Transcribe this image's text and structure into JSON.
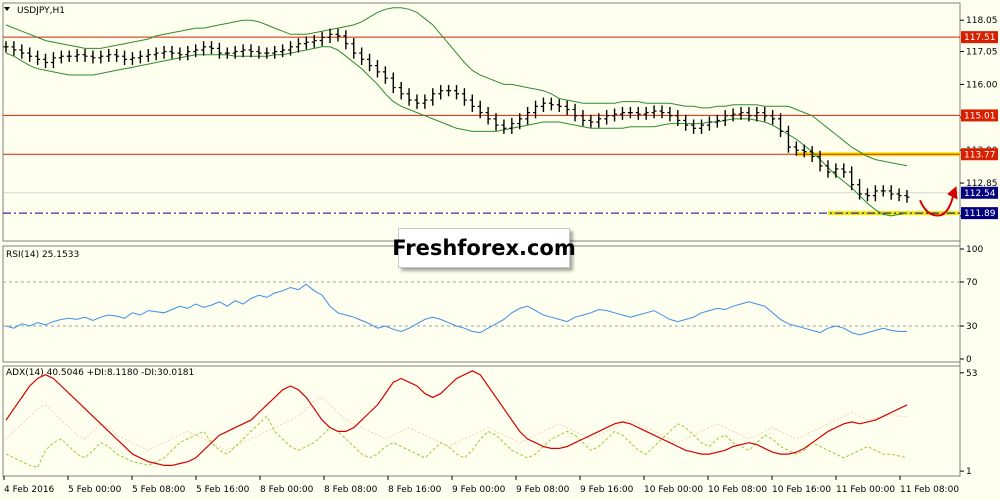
{
  "colors": {
    "background": "#fffff0",
    "candle": "#000000",
    "bollinger": "#2e8b2e",
    "resistance": "#d62000",
    "support_dash": "#00008b",
    "highlight": "#f2e600",
    "rsi_line": "#3c8ee6",
    "adx_line": "#d40000",
    "plus_di": "#99cc33",
    "minus_di": "#f5d0b0",
    "arrow": "#d40000",
    "tag_red": "#d62000",
    "tag_navy": "#000080",
    "tag_last": "#000080"
  },
  "watermark": "Freshforex.com",
  "chart_data": [
    {
      "type": "candlestick",
      "title": "USDJPY,H1",
      "ylim": [
        111.0,
        118.6
      ],
      "yticks": [
        "118.05",
        "117.05",
        "116.00",
        "114.95",
        "113.90",
        "112.85",
        "111.80"
      ],
      "x_labels": [
        "4 Feb 2016",
        "5 Feb 00:00",
        "5 Feb 08:00",
        "5 Feb 16:00",
        "8 Feb 00:00",
        "8 Feb 08:00",
        "8 Feb 16:00",
        "9 Feb 00:00",
        "9 Feb 08:00",
        "9 Feb 16:00",
        "10 Feb 00:00",
        "10 Feb 08:00",
        "10 Feb 16:00",
        "11 Feb 00:00",
        "11 Feb 08:00"
      ],
      "close": [
        117.2,
        117.1,
        117.0,
        116.9,
        116.8,
        116.7,
        116.85,
        116.9,
        116.9,
        116.95,
        116.9,
        116.85,
        116.9,
        116.95,
        116.9,
        116.8,
        116.85,
        116.9,
        116.95,
        117.0,
        117.05,
        117.0,
        116.95,
        117.05,
        117.1,
        117.2,
        117.15,
        117.0,
        117.0,
        117.05,
        117.1,
        117.05,
        117.0,
        117.0,
        117.05,
        117.1,
        117.2,
        117.3,
        117.35,
        117.4,
        117.5,
        117.6,
        117.55,
        117.3,
        117.0,
        116.8,
        116.6,
        116.4,
        116.2,
        115.9,
        115.7,
        115.5,
        115.4,
        115.5,
        115.7,
        115.8,
        115.8,
        115.7,
        115.5,
        115.3,
        115.1,
        114.9,
        114.7,
        114.6,
        114.75,
        114.9,
        115.1,
        115.3,
        115.4,
        115.35,
        115.3,
        115.2,
        115.0,
        114.85,
        114.8,
        114.9,
        115.0,
        115.05,
        115.1,
        115.1,
        115.05,
        115.1,
        115.15,
        115.1,
        115.0,
        114.85,
        114.7,
        114.6,
        114.7,
        114.8,
        114.85,
        115.0,
        115.05,
        115.1,
        115.0,
        115.1,
        115.0,
        114.9,
        114.5,
        114.0,
        113.9,
        113.85,
        113.7,
        113.4,
        113.2,
        113.3,
        113.2,
        112.8,
        112.5,
        112.45,
        112.6,
        112.6,
        112.5,
        112.45,
        112.4
      ],
      "bollinger_upper": [
        117.9,
        117.8,
        117.7,
        117.6,
        117.5,
        117.4,
        117.35,
        117.3,
        117.25,
        117.2,
        117.15,
        117.15,
        117.15,
        117.2,
        117.25,
        117.3,
        117.35,
        117.4,
        117.45,
        117.55,
        117.6,
        117.65,
        117.7,
        117.75,
        117.8,
        117.8,
        117.85,
        117.9,
        117.95,
        118.0,
        118.05,
        118.05,
        118.0,
        117.9,
        117.8,
        117.7,
        117.6,
        117.6,
        117.6,
        117.65,
        117.7,
        117.75,
        117.8,
        117.85,
        117.9,
        118.0,
        118.15,
        118.3,
        118.4,
        118.45,
        118.45,
        118.4,
        118.3,
        118.1,
        117.9,
        117.6,
        117.3,
        117.0,
        116.7,
        116.45,
        116.3,
        116.2,
        116.1,
        116.0,
        116.0,
        115.95,
        115.9,
        115.85,
        115.8,
        115.7,
        115.55,
        115.5,
        115.45,
        115.4,
        115.4,
        115.4,
        115.4,
        115.4,
        115.45,
        115.45,
        115.45,
        115.4,
        115.4,
        115.4,
        115.4,
        115.35,
        115.3,
        115.3,
        115.25,
        115.25,
        115.3,
        115.3,
        115.35,
        115.35,
        115.35,
        115.35,
        115.3,
        115.3,
        115.3,
        115.3,
        115.2,
        115.1,
        115.0,
        114.8,
        114.6,
        114.4,
        114.2,
        114.0,
        113.85,
        113.7,
        113.6,
        113.55,
        113.5,
        113.45,
        113.4
      ],
      "bollinger_lower": [
        117.0,
        116.9,
        116.75,
        116.6,
        116.5,
        116.45,
        116.4,
        116.35,
        116.3,
        116.3,
        116.3,
        116.3,
        116.35,
        116.4,
        116.45,
        116.5,
        116.55,
        116.6,
        116.65,
        116.7,
        116.75,
        116.8,
        116.85,
        116.9,
        116.95,
        116.95,
        116.95,
        116.95,
        116.95,
        116.9,
        116.9,
        116.9,
        116.9,
        116.9,
        116.95,
        116.95,
        117.0,
        117.05,
        117.1,
        117.15,
        117.2,
        117.2,
        117.1,
        116.9,
        116.7,
        116.5,
        116.25,
        116.0,
        115.7,
        115.45,
        115.3,
        115.2,
        115.1,
        115.0,
        114.9,
        114.8,
        114.7,
        114.6,
        114.55,
        114.5,
        114.5,
        114.5,
        114.5,
        114.55,
        114.6,
        114.65,
        114.7,
        114.75,
        114.8,
        114.8,
        114.8,
        114.75,
        114.7,
        114.65,
        114.6,
        114.6,
        114.6,
        114.6,
        114.6,
        114.65,
        114.65,
        114.65,
        114.65,
        114.7,
        114.75,
        114.75,
        114.75,
        114.75,
        114.75,
        114.8,
        114.8,
        114.85,
        114.9,
        114.9,
        114.9,
        114.85,
        114.8,
        114.7,
        114.55,
        114.4,
        114.25,
        114.05,
        113.85,
        113.6,
        113.35,
        113.1,
        112.9,
        112.7,
        112.45,
        112.2,
        112.0,
        111.85,
        111.8,
        111.85,
        111.9
      ],
      "levels": [
        {
          "value": 117.51,
          "label": "117.51",
          "style": "solid"
        },
        {
          "value": 115.01,
          "label": "115.01",
          "style": "solid"
        },
        {
          "value": 113.77,
          "label": "113.77",
          "style": "solid"
        },
        {
          "value": 111.89,
          "label": "111.89",
          "style": "dashdot"
        }
      ],
      "last_price": {
        "value": 112.54,
        "label": "112.54"
      },
      "highlight_zones": [
        {
          "from": 100,
          "to": 114,
          "value": 113.77
        },
        {
          "from": 104,
          "to": 114,
          "value": 111.89
        }
      ],
      "projection_arrow": true
    },
    {
      "type": "line",
      "title": "RSI(14) 25.1533",
      "ylim": [
        0,
        100
      ],
      "yticks": [
        "100",
        "70",
        "30",
        "0"
      ],
      "levels": [
        70,
        30
      ],
      "values": [
        30,
        28,
        32,
        30,
        33,
        31,
        34,
        36,
        37,
        36,
        38,
        35,
        38,
        40,
        39,
        37,
        42,
        40,
        44,
        43,
        42,
        45,
        48,
        46,
        50,
        47,
        49,
        52,
        48,
        53,
        50,
        55,
        58,
        56,
        60,
        62,
        65,
        63,
        68,
        62,
        58,
        48,
        42,
        40,
        38,
        35,
        32,
        28,
        30,
        27,
        25,
        28,
        32,
        36,
        38,
        36,
        33,
        30,
        28,
        25,
        24,
        28,
        32,
        36,
        42,
        46,
        48,
        44,
        40,
        38,
        36,
        34,
        38,
        40,
        42,
        45,
        44,
        42,
        40,
        38,
        40,
        42,
        44,
        40,
        36,
        34,
        36,
        38,
        42,
        44,
        46,
        45,
        48,
        50,
        52,
        50,
        48,
        42,
        36,
        32,
        30,
        28,
        26,
        24,
        28,
        30,
        28,
        24,
        22,
        24,
        26,
        28,
        26,
        25,
        25
      ]
    },
    {
      "type": "line",
      "title": "ADX(14) 40.5046 +DI:8.1180 -DI:30.0181",
      "ylim": [
        0,
        55
      ],
      "yticks": [
        "53",
        "1"
      ],
      "adx": [
        28,
        34,
        40,
        46,
        50,
        52,
        50,
        46,
        42,
        38,
        34,
        30,
        26,
        22,
        18,
        14,
        10,
        8,
        6,
        5,
        4,
        4,
        5,
        6,
        8,
        12,
        16,
        20,
        22,
        24,
        26,
        28,
        32,
        36,
        40,
        44,
        46,
        44,
        40,
        34,
        28,
        24,
        22,
        22,
        24,
        28,
        32,
        36,
        42,
        48,
        50,
        48,
        46,
        42,
        40,
        42,
        46,
        50,
        52,
        54,
        52,
        46,
        40,
        34,
        28,
        22,
        18,
        16,
        14,
        13,
        13,
        14,
        16,
        18,
        20,
        22,
        24,
        26,
        27,
        26,
        24,
        22,
        20,
        18,
        16,
        14,
        12,
        11,
        10,
        10,
        11,
        12,
        14,
        15,
        16,
        15,
        13,
        11,
        10,
        10,
        11,
        13,
        16,
        19,
        22,
        24,
        26,
        27,
        26,
        27,
        28,
        30,
        32,
        34,
        36
      ],
      "plus_di": [
        10,
        8,
        6,
        4,
        3,
        12,
        16,
        18,
        14,
        10,
        8,
        12,
        16,
        14,
        10,
        8,
        6,
        5,
        4,
        6,
        8,
        12,
        16,
        18,
        20,
        22,
        16,
        12,
        10,
        14,
        18,
        22,
        26,
        30,
        22,
        18,
        14,
        12,
        14,
        16,
        20,
        24,
        22,
        18,
        14,
        10,
        8,
        10,
        14,
        16,
        14,
        12,
        10,
        8,
        12,
        16,
        14,
        10,
        8,
        12,
        18,
        22,
        20,
        16,
        12,
        10,
        8,
        10,
        14,
        18,
        20,
        22,
        20,
        16,
        12,
        14,
        18,
        22,
        20,
        16,
        12,
        10,
        14,
        18,
        22,
        26,
        24,
        20,
        16,
        14,
        18,
        20,
        16,
        14,
        12,
        16,
        20,
        18,
        14,
        12,
        10,
        12,
        16,
        14,
        12,
        10,
        8,
        10,
        12,
        14,
        12,
        10,
        10,
        9,
        8
      ],
      "minus_di": [
        18,
        22,
        26,
        30,
        34,
        36,
        32,
        28,
        24,
        20,
        18,
        22,
        26,
        24,
        20,
        18,
        16,
        14,
        12,
        14,
        16,
        18,
        20,
        22,
        20,
        18,
        16,
        14,
        12,
        14,
        16,
        18,
        20,
        22,
        24,
        26,
        28,
        30,
        34,
        38,
        40,
        36,
        32,
        28,
        26,
        24,
        22,
        20,
        18,
        20,
        22,
        24,
        22,
        20,
        18,
        16,
        14,
        16,
        18,
        20,
        22,
        24,
        22,
        20,
        18,
        16,
        18,
        20,
        22,
        24,
        26,
        24,
        22,
        20,
        18,
        20,
        22,
        24,
        26,
        28,
        26,
        24,
        22,
        20,
        18,
        16,
        18,
        20,
        22,
        24,
        26,
        24,
        22,
        20,
        18,
        20,
        22,
        24,
        22,
        20,
        18,
        20,
        22,
        24,
        26,
        28,
        30,
        32,
        30,
        28,
        29,
        30,
        31,
        30,
        30
      ]
    }
  ]
}
